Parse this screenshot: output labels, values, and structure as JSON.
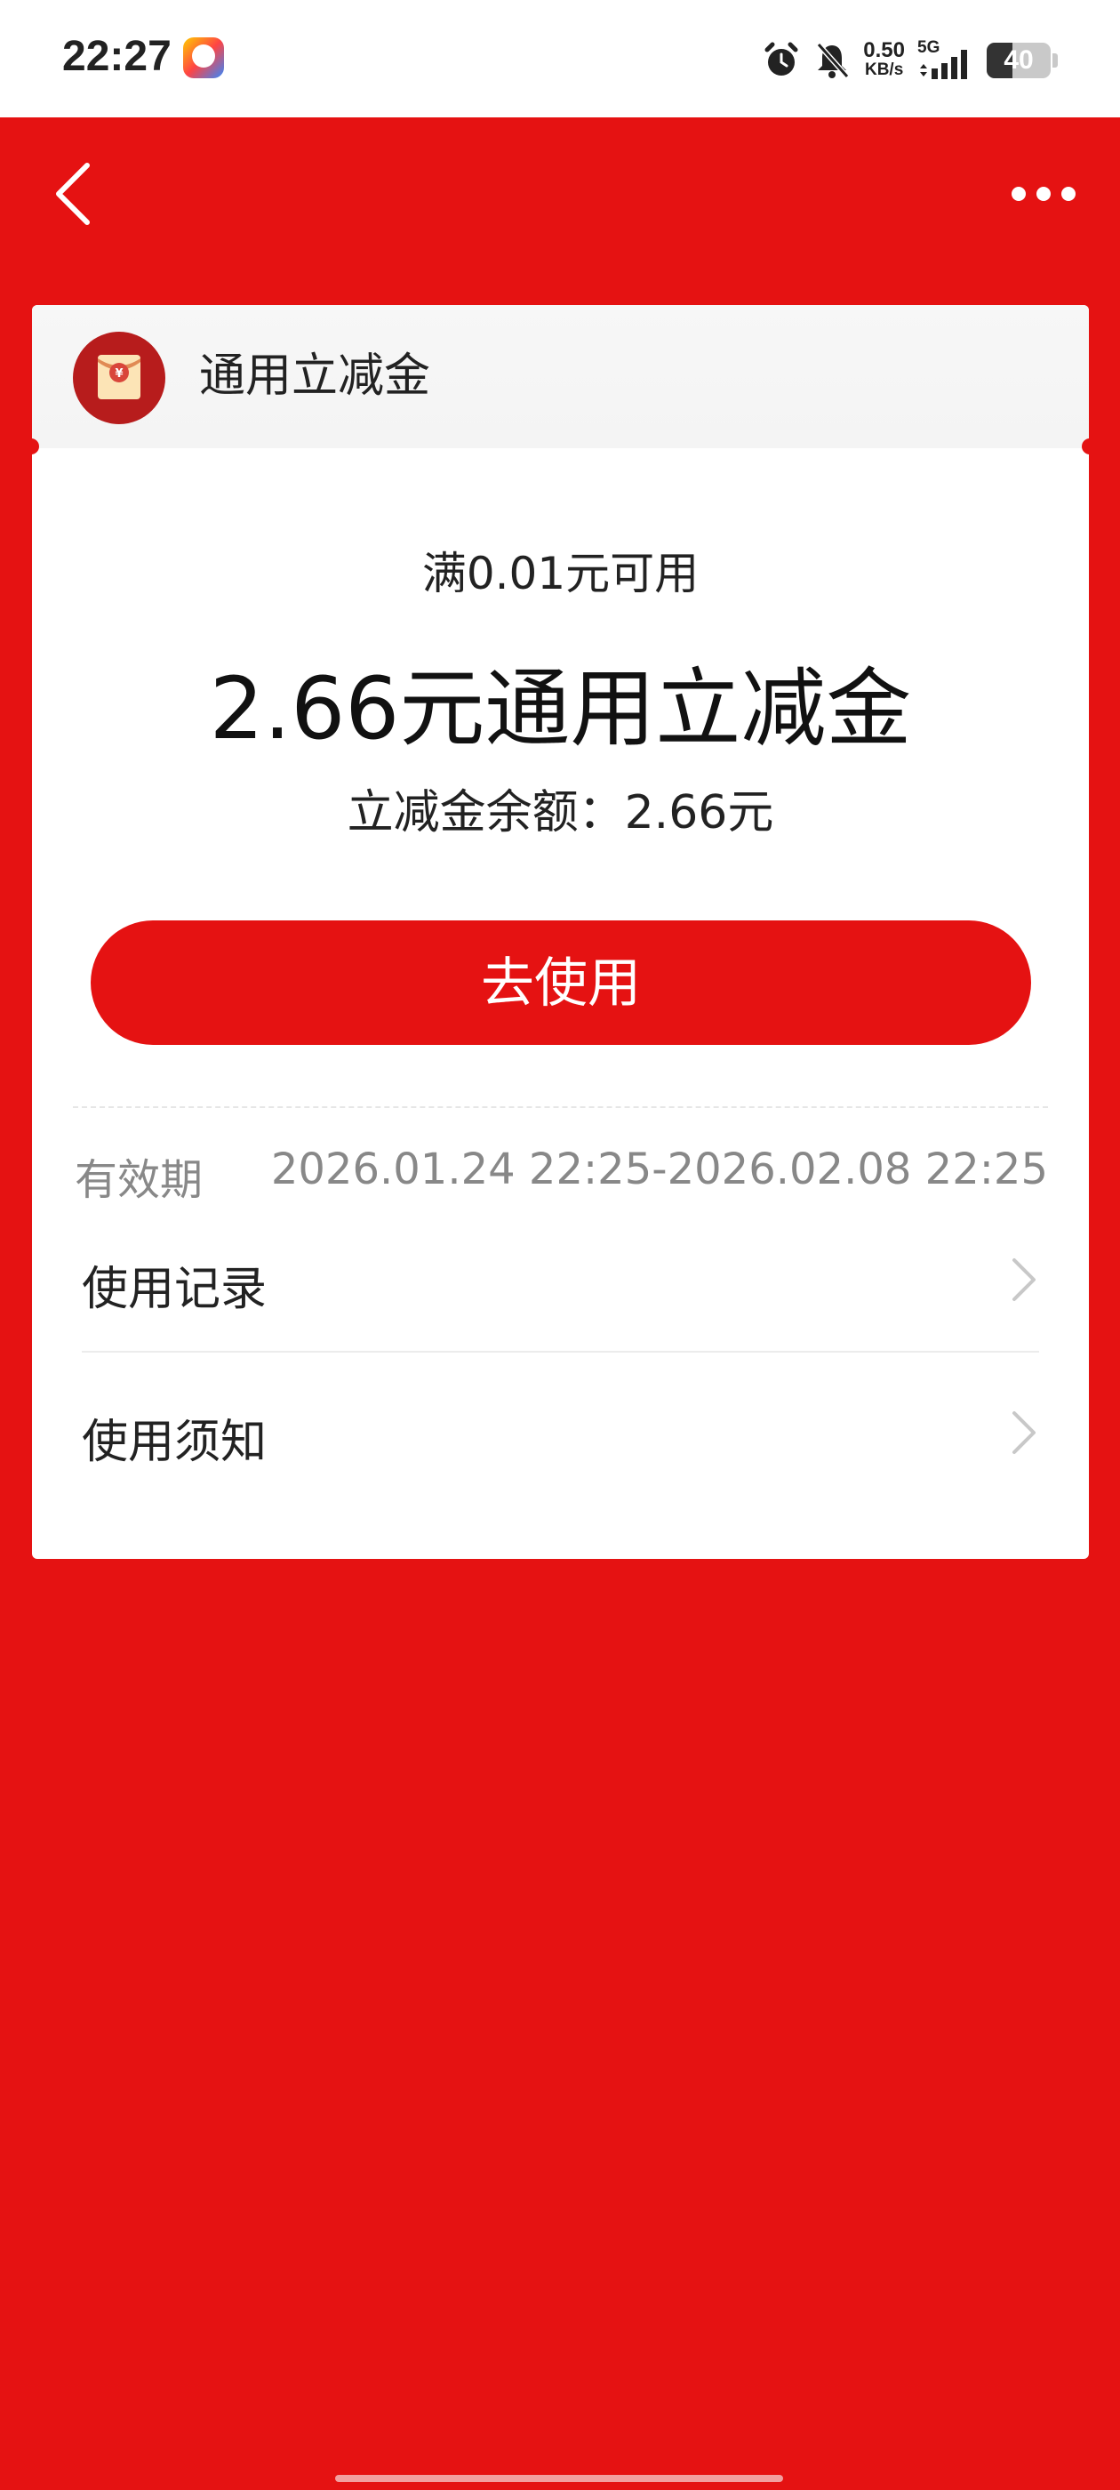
{
  "status_bar": {
    "time": "22:27",
    "net_speed_value": "0.50",
    "net_speed_unit": "KB/s",
    "network_type": "5G",
    "battery_level": "40",
    "icons": [
      "app-badge-icon",
      "alarm-icon",
      "mute-bell-icon",
      "signal-icon",
      "battery-icon"
    ]
  },
  "nav": {
    "back_icon": "chevron-left-icon",
    "more_icon": "more-dots-icon"
  },
  "card": {
    "header_icon": "red-packet-icon",
    "title": "通用立减金",
    "threshold": "满0.01元可用",
    "amount_title": "2.66元通用立减金",
    "balance": "立减金余额：2.66元",
    "use_button": "去使用",
    "validity_label": "有效期",
    "validity_value": "2026.01.24 22:25-2026.02.08 22:25",
    "rows": [
      {
        "label": "使用记录"
      },
      {
        "label": "使用须知"
      }
    ]
  },
  "colors": {
    "brand_red": "#e51212",
    "card_bg": "#ffffff",
    "header_bg": "#f6f6f6",
    "muted_text": "#888888"
  }
}
